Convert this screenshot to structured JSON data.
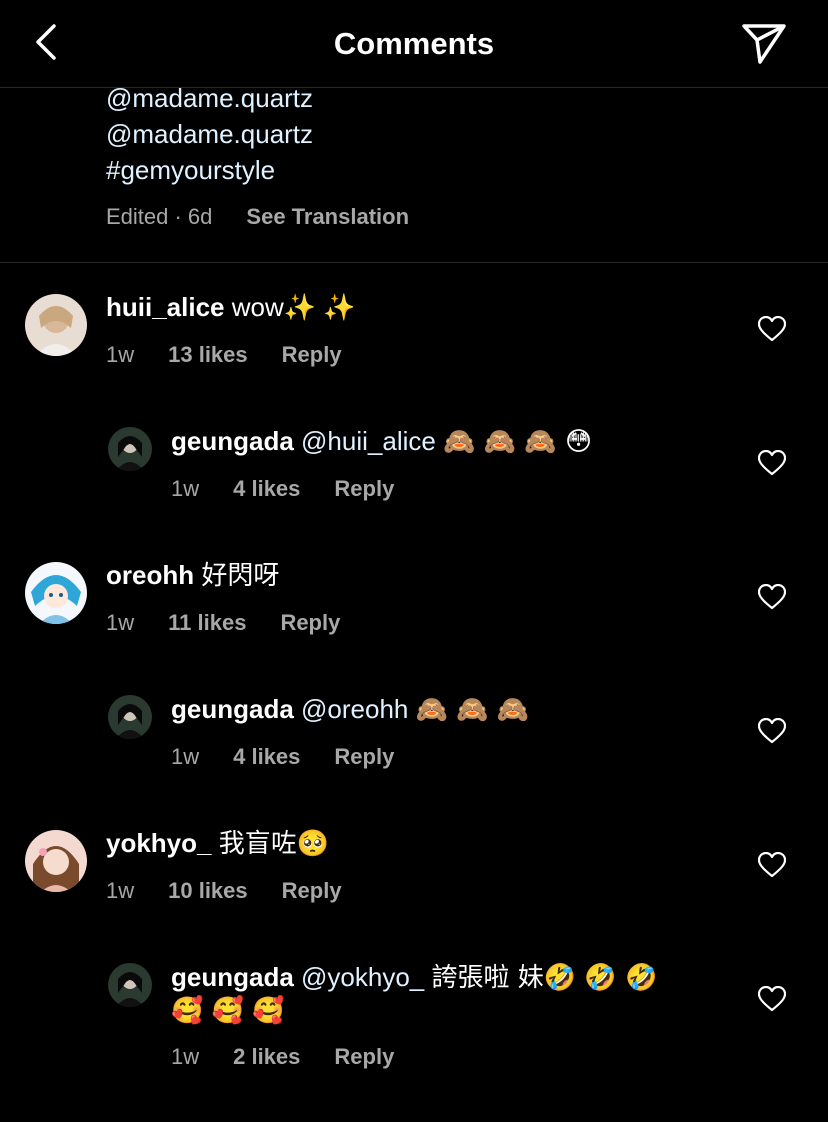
{
  "header": {
    "title": "Comments",
    "back_icon": "chevron-left-icon",
    "share_icon": "paper-plane-icon"
  },
  "caption": {
    "lines": [
      "@madame.quartz",
      "@madame.quartz",
      "#gemyourstyle"
    ],
    "meta": "Edited · 6d",
    "see_translation": "See Translation"
  },
  "comments": [
    {
      "user": "huii_alice",
      "mention": "",
      "text": "wow✨ ✨",
      "time": "1w",
      "likes": "13 likes",
      "reply": "Reply"
    },
    {
      "user": "geungada",
      "mention": "@huii_alice",
      "text": "🙈 🙈 🙈 😳",
      "time": "1w",
      "likes": "4 likes",
      "reply": "Reply"
    },
    {
      "user": "oreohh",
      "mention": "",
      "text": "好閃呀",
      "time": "1w",
      "likes": "11 likes",
      "reply": "Reply"
    },
    {
      "user": "geungada",
      "mention": "@oreohh",
      "text": "🙈 🙈 🙈",
      "time": "1w",
      "likes": "4 likes",
      "reply": "Reply"
    },
    {
      "user": "yokhyo_",
      "mention": "",
      "text": "我盲咗🥺",
      "time": "1w",
      "likes": "10 likes",
      "reply": "Reply"
    },
    {
      "user": "geungada",
      "mention": "@yokhyo_",
      "text": "誇張啦 妹🤣 🤣 🤣",
      "text2": "🥰 🥰 🥰",
      "time": "1w",
      "likes": "2 likes",
      "reply": "Reply"
    }
  ],
  "colors": {
    "background": "#000000",
    "mention": "#e0f1ff",
    "secondary": "#a8a8a8"
  }
}
